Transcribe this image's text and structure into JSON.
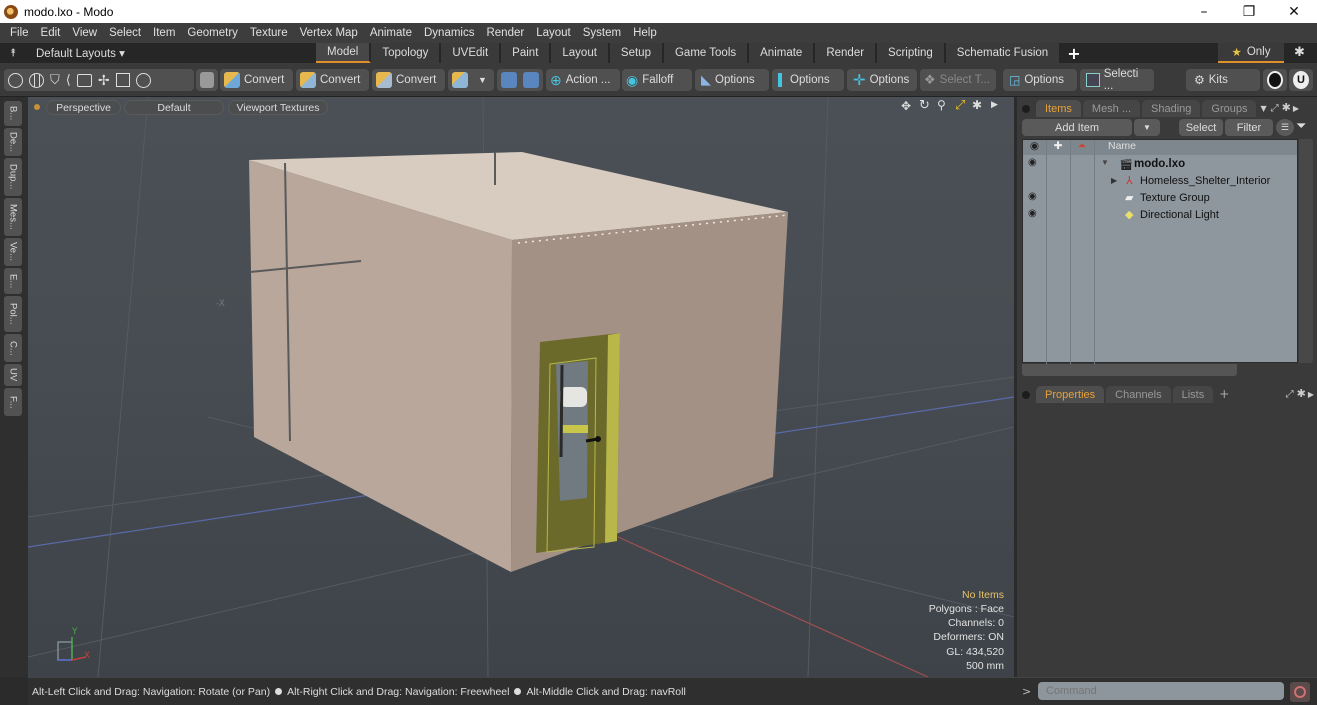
{
  "window": {
    "title": "modo.lxo - Modo",
    "controls": {
      "minimize": "–",
      "restore": "❐",
      "close": "✕"
    }
  },
  "menu": [
    "File",
    "Edit",
    "View",
    "Select",
    "Item",
    "Geometry",
    "Texture",
    "Vertex Map",
    "Animate",
    "Dynamics",
    "Render",
    "Layout",
    "System",
    "Help"
  ],
  "layout_bar": {
    "layouts_label": "Default Layouts ▾",
    "tabs": [
      "Model",
      "Topology",
      "UVEdit",
      "Paint",
      "Layout",
      "Setup",
      "Game Tools",
      "Animate",
      "Render",
      "Scripting",
      "Schematic Fusion"
    ],
    "active_tab": "Model",
    "add_tab": "+",
    "only_label": "Only",
    "star": "★",
    "gear": "✱"
  },
  "toolbar": {
    "convert1": "Convert",
    "convert2": "Convert",
    "convert3": "Convert",
    "action": "Action ...",
    "falloff": "Falloff",
    "options1": "Options",
    "options2": "Options",
    "options3": "Options",
    "select_t": "Select T...",
    "options4": "Options",
    "selecti": "Selecti ...",
    "kits": "Kits"
  },
  "left_tabs": [
    "B...",
    "De...",
    "Dup...",
    "Mes...",
    "Ve...",
    "E...",
    "Pol...",
    "C...",
    "UV",
    "F..."
  ],
  "viewport": {
    "view_mode": "Perspective",
    "shading": "Default",
    "textures": "Viewport Textures",
    "axis_label_x": "-X",
    "gizmo": {
      "y": "Y",
      "x": "X"
    },
    "hud": {
      "selection": "No Items",
      "polygons": "Polygons : Face",
      "channels": "Channels: 0",
      "deformers": "Deformers: ON",
      "gl": "GL: 434,520",
      "scale": "500 mm"
    },
    "colors": {
      "wall": "#b9a79c",
      "roof": "#d8cbc0",
      "front": "#a39185",
      "door": "#6b6a2a",
      "door_frame": "#b8b84a"
    }
  },
  "status_bar": {
    "hint1": "Alt-Left Click and Drag: Navigation: Rotate (or Pan)",
    "hint2": "Alt-Right Click and Drag: Navigation: Freewheel",
    "hint3": "Alt-Middle Click and Drag: navRoll"
  },
  "items_panel": {
    "tabs": [
      "Items",
      "Mesh ...",
      "Shading",
      "Groups"
    ],
    "active_tab": "Items",
    "add_item": "Add Item",
    "select": "Select",
    "filter": "Filter",
    "column_name": "Name",
    "rows": [
      {
        "name": "modo.lxo",
        "visible": true,
        "bold": true,
        "indent": 0
      },
      {
        "name": "Homeless_Shelter_Interior",
        "visible": false,
        "bold": false,
        "indent": 1
      },
      {
        "name": "Texture Group",
        "visible": true,
        "bold": false,
        "indent": 1
      },
      {
        "name": "Directional Light",
        "visible": true,
        "bold": false,
        "indent": 1
      }
    ]
  },
  "properties_panel": {
    "tabs": [
      "Properties",
      "Channels",
      "Lists"
    ],
    "active_tab": "Properties",
    "add": "+"
  },
  "command": {
    "prompt": ">",
    "placeholder": "Command"
  }
}
